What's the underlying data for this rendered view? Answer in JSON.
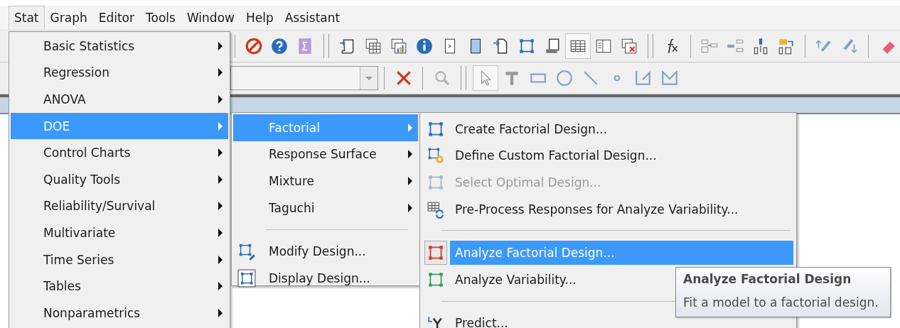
{
  "menubar": [
    {
      "label": "Stat",
      "selected": true
    },
    {
      "label": "Graph",
      "selected": false
    },
    {
      "label": "Editor",
      "selected": false
    },
    {
      "label": "Tools",
      "selected": false
    },
    {
      "label": "Window",
      "selected": false
    },
    {
      "label": "Help",
      "selected": false
    },
    {
      "label": "Assistant",
      "selected": false
    }
  ],
  "toolbar_1": [
    {
      "kind": "separator"
    },
    {
      "kind": "button",
      "selected": false
    },
    {
      "kind": "button",
      "selected": false
    },
    {
      "kind": "button",
      "selected": false
    },
    {
      "kind": "grip"
    },
    {
      "kind": "button",
      "selected": false
    },
    {
      "kind": "button",
      "selected": false
    },
    {
      "kind": "button",
      "selected": false
    },
    {
      "kind": "button",
      "selected": false
    },
    {
      "kind": "button",
      "selected": false
    },
    {
      "kind": "button",
      "selected": false
    },
    {
      "kind": "button",
      "selected": false
    },
    {
      "kind": "button",
      "selected": false
    },
    {
      "kind": "button",
      "selected": false
    },
    {
      "kind": "button",
      "selected": true
    },
    {
      "kind": "button",
      "selected": false
    },
    {
      "kind": "button",
      "selected": false
    },
    {
      "kind": "grip"
    },
    {
      "kind": "button",
      "selected": false
    },
    {
      "kind": "separator"
    },
    {
      "kind": "button",
      "selected": false
    },
    {
      "kind": "button",
      "selected": false
    },
    {
      "kind": "button",
      "selected": false
    },
    {
      "kind": "button",
      "selected": false
    },
    {
      "kind": "separator"
    },
    {
      "kind": "button",
      "selected": false
    },
    {
      "kind": "button",
      "selected": false
    },
    {
      "kind": "separator"
    },
    {
      "kind": "button",
      "selected": false
    }
  ],
  "toolbar_2": [
    {
      "kind": "combo"
    },
    {
      "kind": "separator"
    },
    {
      "kind": "button",
      "selected": false
    },
    {
      "kind": "separator"
    },
    {
      "kind": "button",
      "selected": false
    },
    {
      "kind": "grip"
    },
    {
      "kind": "button",
      "selected": true
    },
    {
      "kind": "button",
      "selected": false
    },
    {
      "kind": "button",
      "selected": false
    },
    {
      "kind": "button",
      "selected": false
    },
    {
      "kind": "button",
      "selected": false
    },
    {
      "kind": "button",
      "selected": false
    },
    {
      "kind": "button",
      "selected": false
    },
    {
      "kind": "button",
      "selected": false
    }
  ],
  "stat_menu": [
    {
      "label": "Basic Statistics",
      "submenu": true,
      "selected": false
    },
    {
      "label": "Regression",
      "submenu": true,
      "selected": false
    },
    {
      "label": "ANOVA",
      "submenu": true,
      "selected": false
    },
    {
      "label": "DOE",
      "submenu": true,
      "selected": true
    },
    {
      "label": "Control Charts",
      "submenu": true,
      "selected": false
    },
    {
      "label": "Quality Tools",
      "submenu": true,
      "selected": false
    },
    {
      "label": "Reliability/Survival",
      "submenu": true,
      "selected": false
    },
    {
      "label": "Multivariate",
      "submenu": true,
      "selected": false
    },
    {
      "label": "Time Series",
      "submenu": true,
      "selected": false
    },
    {
      "label": "Tables",
      "submenu": true,
      "selected": false
    },
    {
      "label": "Nonparametrics",
      "submenu": true,
      "selected": false
    }
  ],
  "doe_menu": [
    {
      "kind": "item",
      "label": "Factorial",
      "submenu": true,
      "selected": true
    },
    {
      "kind": "item",
      "label": "Response Surface",
      "submenu": true,
      "selected": false
    },
    {
      "kind": "item",
      "label": "Mixture",
      "submenu": true,
      "selected": false
    },
    {
      "kind": "item",
      "label": "Taguchi",
      "submenu": true,
      "selected": false
    },
    {
      "kind": "separator"
    },
    {
      "kind": "item",
      "label": "Modify Design...",
      "submenu": false,
      "selected": false
    },
    {
      "kind": "item",
      "label": "Display Design...",
      "submenu": false,
      "selected": false
    }
  ],
  "factorial_menu": [
    {
      "kind": "item",
      "label": "Create Factorial Design...",
      "selected": false,
      "disabled": false
    },
    {
      "kind": "item",
      "label": "Define Custom Factorial Design...",
      "selected": false,
      "disabled": false
    },
    {
      "kind": "item",
      "label": "Select Optimal Design...",
      "selected": false,
      "disabled": true
    },
    {
      "kind": "item",
      "label": "Pre-Process Responses for Analyze Variability...",
      "selected": false,
      "disabled": false
    },
    {
      "kind": "separator"
    },
    {
      "kind": "item",
      "label": "Analyze Factorial Design...",
      "selected": true,
      "disabled": false
    },
    {
      "kind": "item",
      "label": "Analyze Variability...",
      "selected": false,
      "disabled": false
    },
    {
      "kind": "separator"
    },
    {
      "kind": "item",
      "label": "Predict...",
      "selected": false,
      "disabled": false
    }
  ],
  "tooltip": {
    "title": "Analyze Factorial Design",
    "text": "Fit a model to a factorial design."
  }
}
